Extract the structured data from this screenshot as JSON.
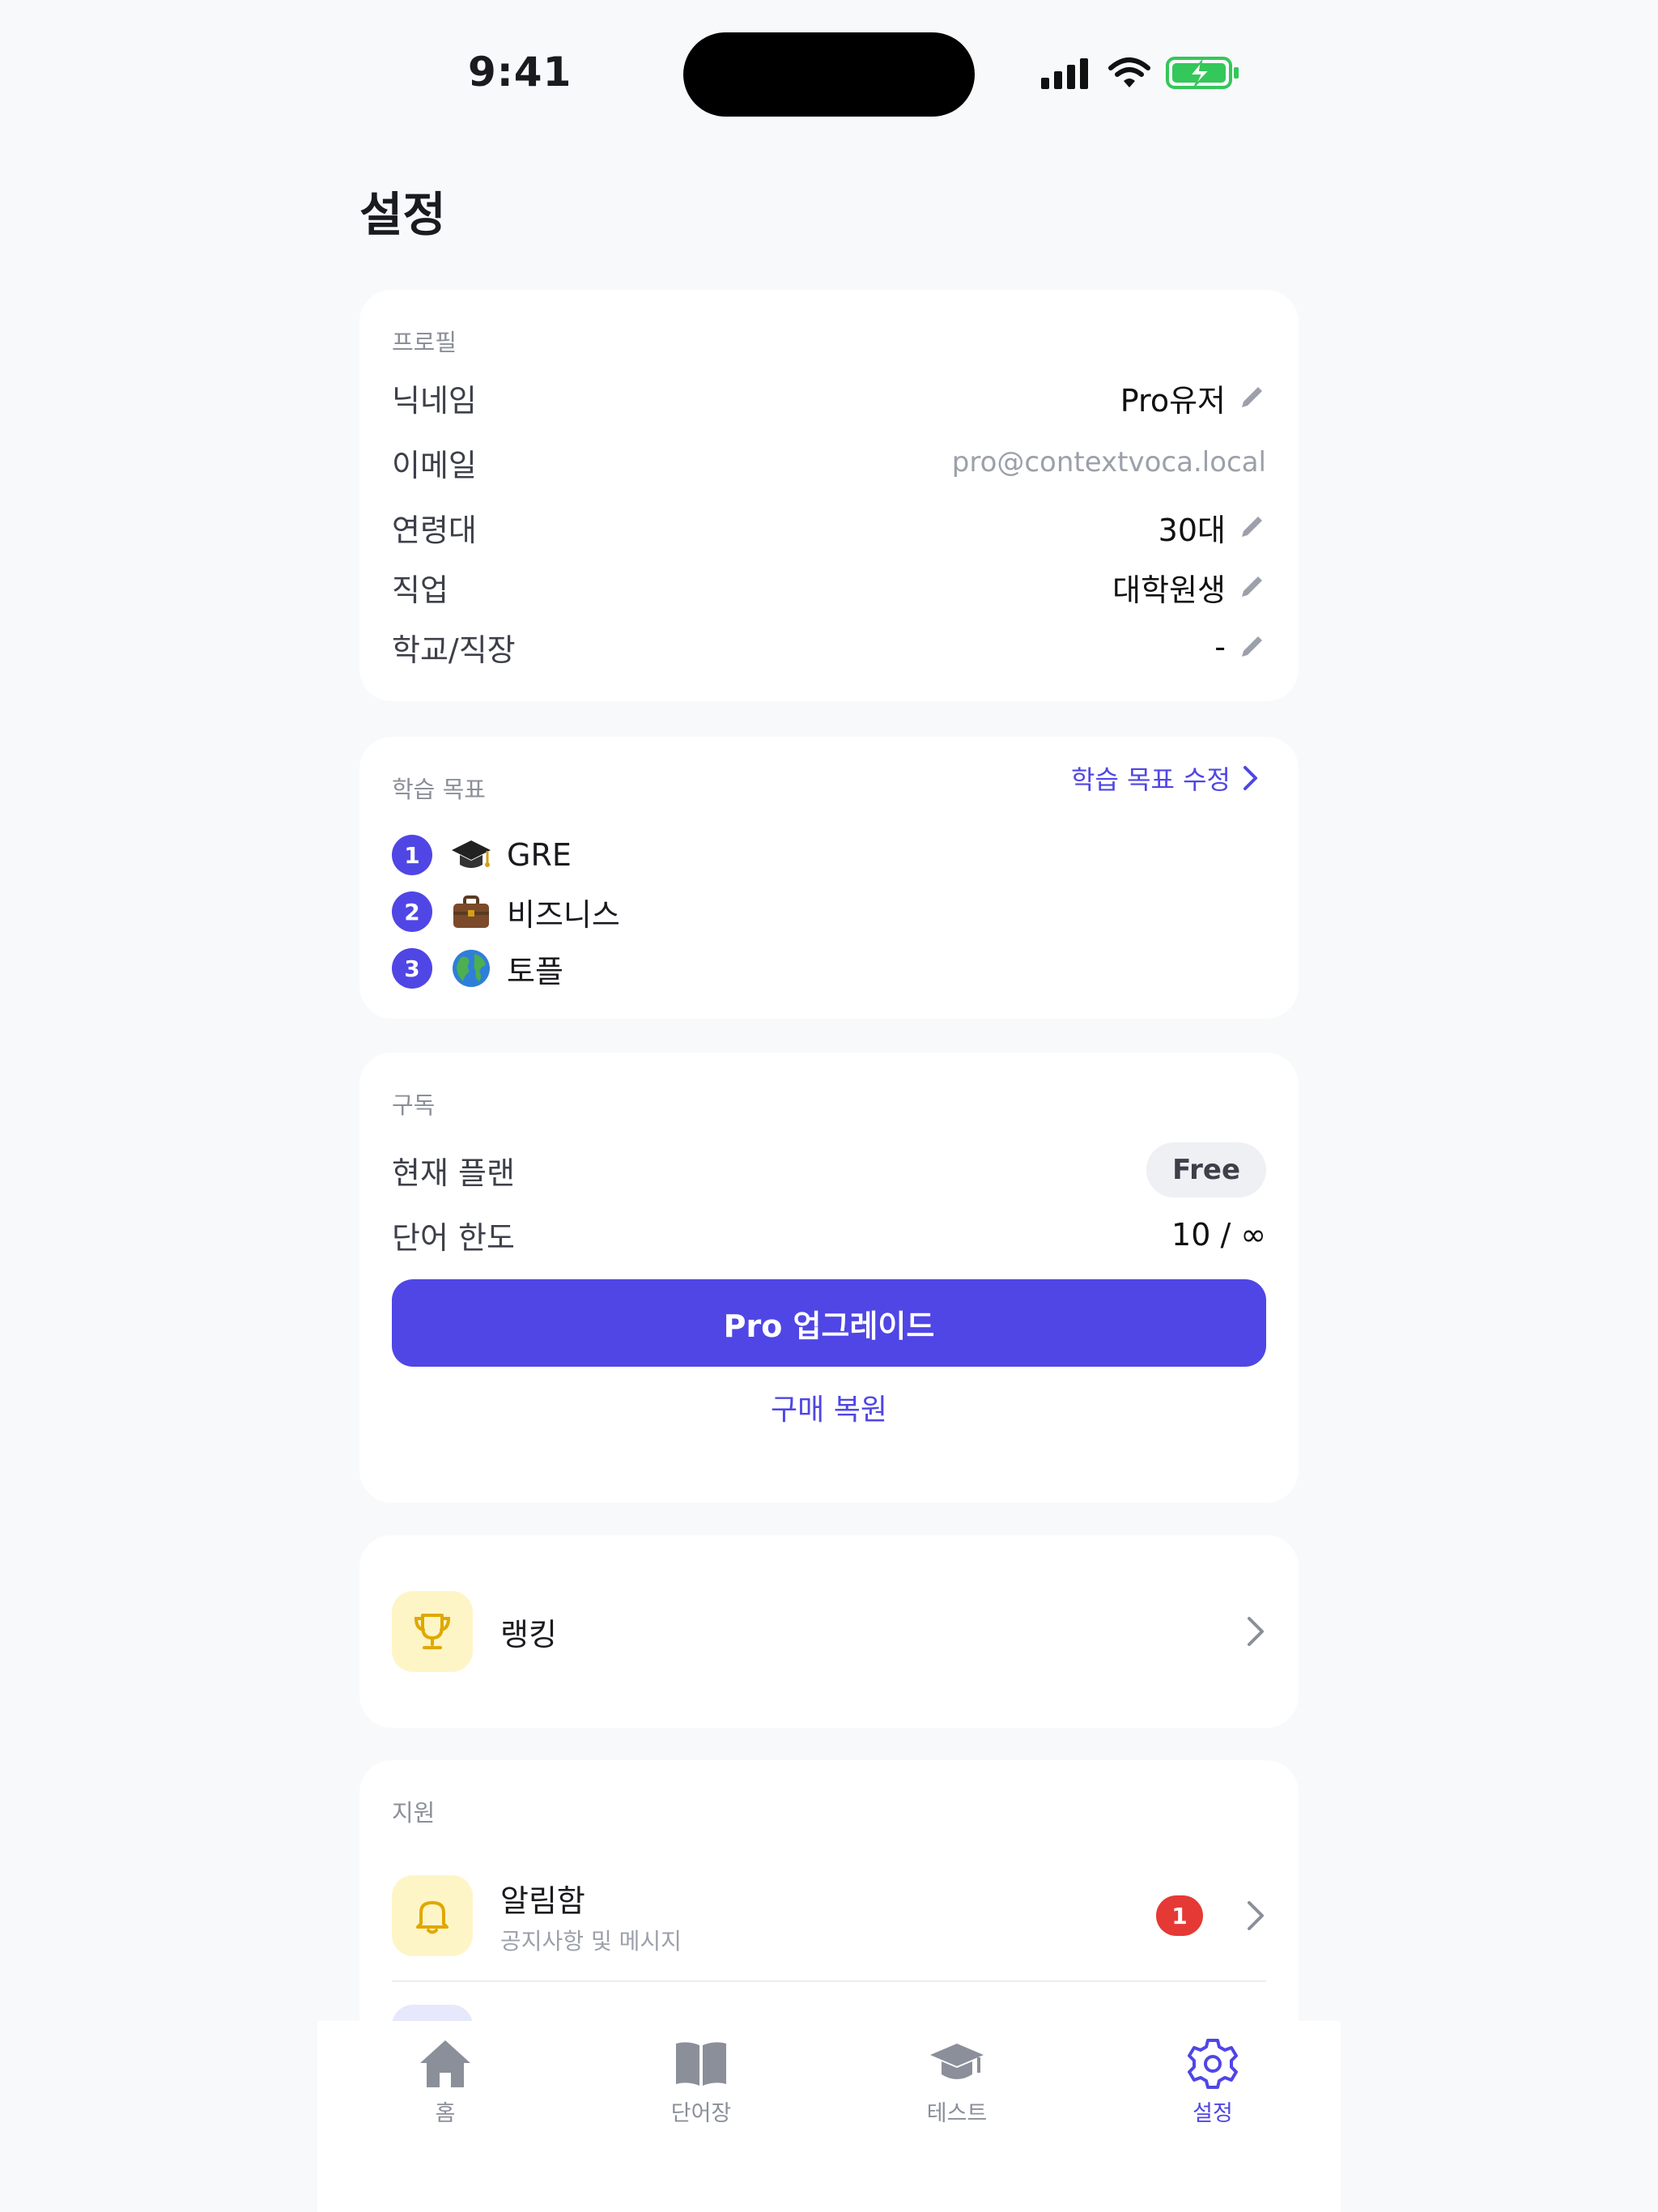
{
  "status_bar": {
    "time": "9:41"
  },
  "page_title": "설정",
  "profile": {
    "section": "프로필",
    "rows": [
      {
        "label": "닉네임",
        "value": "Pro유저",
        "editable": true
      },
      {
        "label": "이메일",
        "value": "pro@contextvoca.local",
        "editable": false
      },
      {
        "label": "연령대",
        "value": "30대",
        "editable": true
      },
      {
        "label": "직업",
        "value": "대학원생",
        "editable": true
      },
      {
        "label": "학교/직장",
        "value": "-",
        "editable": true
      }
    ]
  },
  "goals": {
    "section": "학습 목표",
    "edit_label": "학습 목표 수정",
    "items": [
      {
        "rank": "1",
        "icon": "graduation-cap-icon",
        "label": "GRE"
      },
      {
        "rank": "2",
        "icon": "briefcase-icon",
        "label": "비즈니스"
      },
      {
        "rank": "3",
        "icon": "globe-icon",
        "label": "토플"
      }
    ]
  },
  "subscription": {
    "section": "구독",
    "plan_label": "현재 플랜",
    "plan_value": "Free",
    "limit_label": "단어 한도",
    "limit_value": "10 / ∞",
    "upgrade_button": "Pro 업그레이드",
    "restore_link": "구매 복원"
  },
  "ranking": {
    "icon": "trophy-icon",
    "label": "랭킹"
  },
  "support": {
    "section": "지원",
    "notifications": {
      "icon": "bell-icon",
      "title": "알림함",
      "subtitle": "공지사항 및 메시지",
      "badge": "1"
    }
  },
  "tabbar": {
    "tabs": [
      {
        "label": "홈",
        "icon": "home-icon",
        "active": false
      },
      {
        "label": "단어장",
        "icon": "book-icon",
        "active": false
      },
      {
        "label": "테스트",
        "icon": "graduation-cap-icon",
        "active": false
      },
      {
        "label": "설정",
        "icon": "gear-icon",
        "active": true
      }
    ]
  },
  "colors": {
    "accent": "#4f46e5",
    "background": "#f8f9fb",
    "badge": "#e53935",
    "icon_tile": "#fef5c7"
  }
}
